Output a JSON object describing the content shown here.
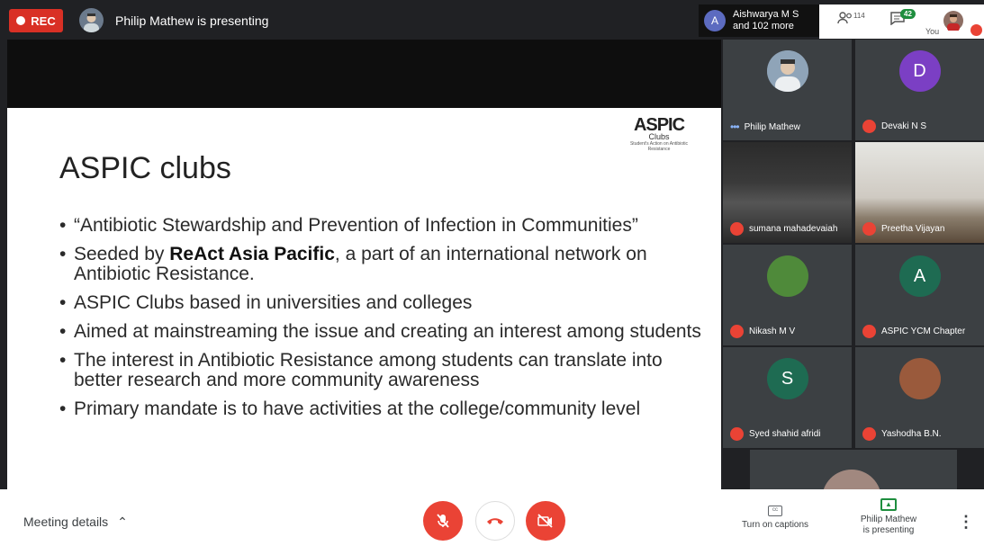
{
  "topbar": {
    "rec_label": "REC",
    "presenter_text": "Philip Mathew is presenting",
    "others_initial": "A",
    "others_line1": "Aishwarya M S",
    "others_line2": "and 102 more",
    "people_count": "114",
    "chat_count": "42",
    "you_label": "You"
  },
  "slide": {
    "logo_main": "ASPIC",
    "logo_sub": "Clubs",
    "logo_tag": "Student's Action on Antibiotic Resistance",
    "title": "ASPIC clubs",
    "bullets": {
      "b1": "“Antibiotic Stewardship and Prevention of Infection in Communities”",
      "b2_pre": "Seeded by ",
      "b2_bold": "ReAct Asia Pacific",
      "b2_post": ", a part of an international network on Antibiotic Resistance.",
      "b3": "ASPIC Clubs based in universities and colleges",
      "b4": "Aimed at mainstreaming the issue and creating an interest among students",
      "b5": "The interest in Antibiotic Resistance among students can translate into better research and more community awareness",
      "b6": "Primary mandate is to have activities at the college/community level"
    }
  },
  "participants": [
    {
      "name": "Philip Mathew",
      "initial": "",
      "muted": false,
      "avatar_color": "#6b7a8c"
    },
    {
      "name": "Devaki N S",
      "initial": "D",
      "muted": true,
      "avatar_color": "#7b3fc4"
    },
    {
      "name": "sumana mahadevaiah",
      "initial": "",
      "muted": true,
      "avatar_color": ""
    },
    {
      "name": "Preetha Vijayan",
      "initial": "",
      "muted": true,
      "avatar_color": ""
    },
    {
      "name": "Nikash M V",
      "initial": "",
      "muted": true,
      "avatar_color": "#4f8a3a"
    },
    {
      "name": "ASPIC YCM Chapter",
      "initial": "A",
      "muted": true,
      "avatar_color": "#1e6b52"
    },
    {
      "name": "Syed shahid afridi",
      "initial": "S",
      "muted": true,
      "avatar_color": "#1e6b52"
    },
    {
      "name": "Yashodha B.N.",
      "initial": "",
      "muted": true,
      "avatar_color": "#9a5a3c"
    }
  ],
  "bottombar": {
    "meeting_details": "Meeting details",
    "captions_label": "Turn on captions",
    "present_line1": "Philip Mathew",
    "present_line2": "is presenting"
  },
  "colors": {
    "accent_red": "#ea4335",
    "rec_red": "#d93025",
    "chat_badge_green": "#1e8e3e"
  }
}
